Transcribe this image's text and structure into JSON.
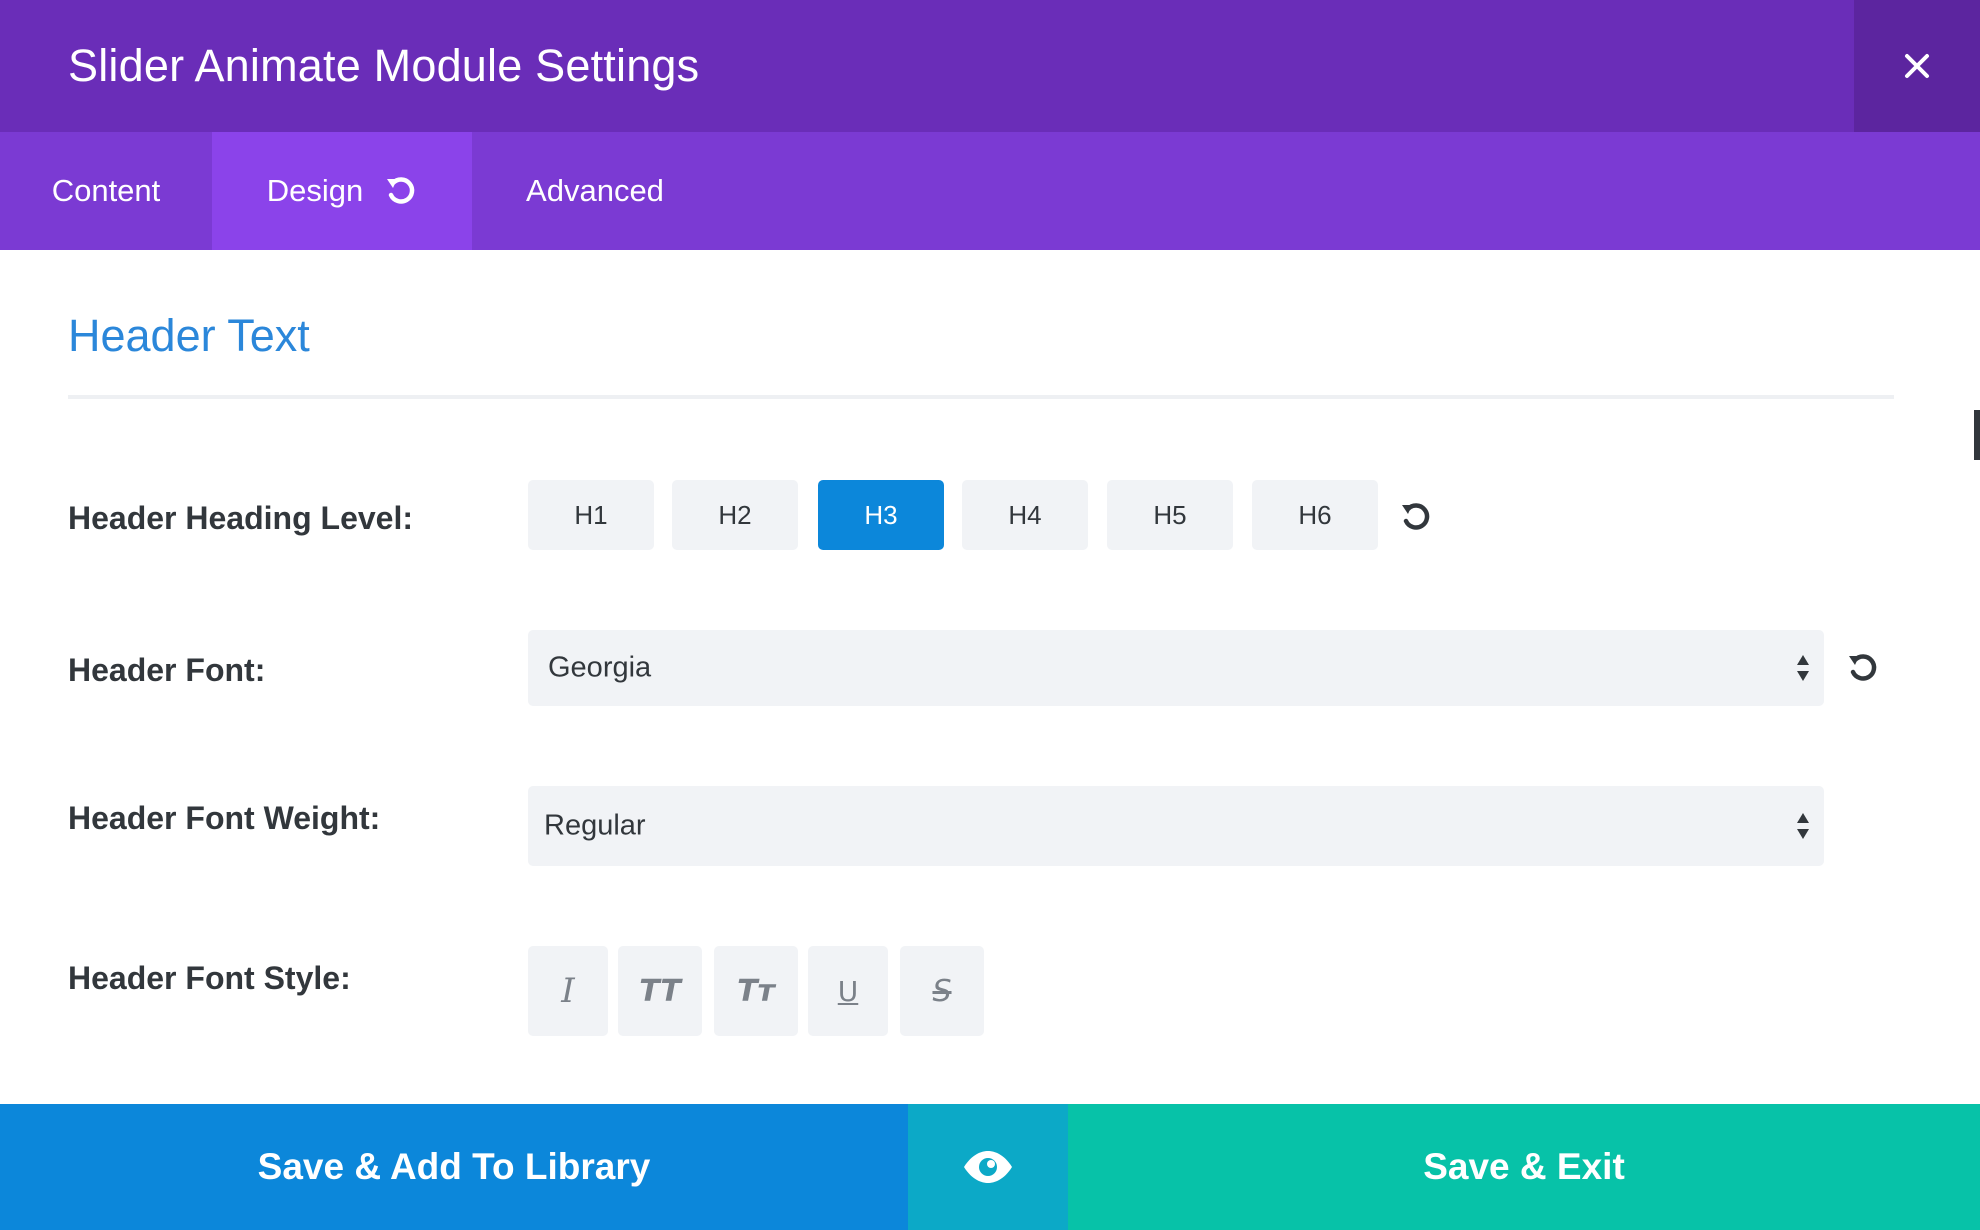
{
  "header": {
    "title": "Slider Animate Module Settings",
    "close_icon": "close-icon"
  },
  "tabs": [
    {
      "label": "Content",
      "active": false
    },
    {
      "label": "Design",
      "active": true,
      "icon": "reset-icon"
    },
    {
      "label": "Advanced",
      "active": false
    }
  ],
  "section": {
    "title": "Header Text"
  },
  "heading_level": {
    "label": "Header Heading Level:",
    "options": [
      "H1",
      "H2",
      "H3",
      "H4",
      "H5",
      "H6"
    ],
    "selected": "H3"
  },
  "header_font": {
    "label": "Header Font:",
    "value": "Georgia"
  },
  "font_weight": {
    "label": "Header Font Weight:",
    "value": "Regular"
  },
  "font_style": {
    "label": "Header Font Style:",
    "buttons": [
      {
        "name": "italic",
        "glyph": "I"
      },
      {
        "name": "uppercase",
        "glyph": "TT"
      },
      {
        "name": "capitalize",
        "glyph": "Tт"
      },
      {
        "name": "underline",
        "glyph": "U"
      },
      {
        "name": "strikethrough",
        "glyph": "S"
      }
    ]
  },
  "footer": {
    "save_library": "Save & Add To Library",
    "preview_icon": "eye-icon",
    "save_exit": "Save & Exit"
  },
  "colors": {
    "title_bar": "#6a2db8",
    "tab_bar": "#7b3ad3",
    "tab_active": "#8b43ea",
    "accent_blue": "#0c87da",
    "preview_teal": "#0ca9c7",
    "save_exit_green": "#07c2a8"
  }
}
